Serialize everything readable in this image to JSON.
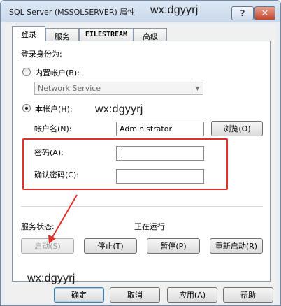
{
  "window": {
    "title": "SQL Server (MSSQLSERVER) 属性",
    "help_button": "?",
    "close_button": "✕"
  },
  "watermark": "wx:dgyyrj",
  "tabs": [
    "登录",
    "服务",
    "FILESTREAM",
    "高级"
  ],
  "logon": {
    "section_label": "登录身份为:",
    "builtin_account_label": "内置帐户(B):",
    "builtin_account_value": "Network Service",
    "this_account_label": "本帐户(H):",
    "account_name_label": "帐户名(N):",
    "account_name_value": "Administrator",
    "browse_button": "浏览(O)",
    "password_label": "密码(A):",
    "password_value": "",
    "confirm_password_label": "确认密码(C):",
    "confirm_password_value": ""
  },
  "service": {
    "status_label": "服务状态:",
    "status_value": "正在运行",
    "start_button": "启动(S)",
    "stop_button": "停止(T)",
    "pause_button": "暂停(P)",
    "restart_button": "重新启动(R)"
  },
  "dialog_buttons": {
    "ok": "确定",
    "cancel": "取消",
    "apply": "应用(A)",
    "help": "帮助"
  },
  "colors": {
    "annotation_red": "#e0302a"
  },
  "icons": {
    "arrow": "red-arrow-annotation"
  }
}
